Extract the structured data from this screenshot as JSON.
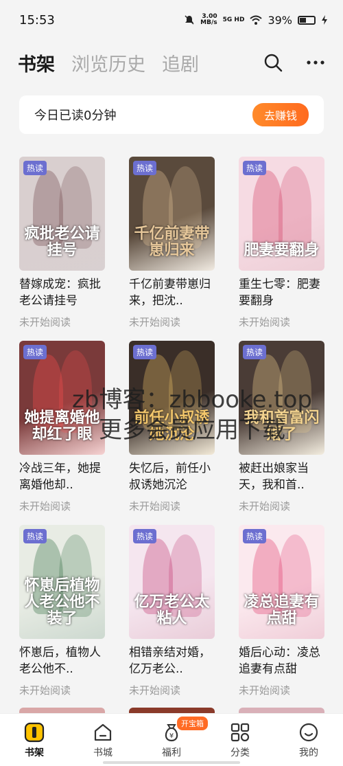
{
  "status": {
    "time": "15:53",
    "speed": "3.00",
    "speed_unit": "MB/s",
    "network": "5G HD",
    "battery": "39%"
  },
  "tabs": [
    {
      "label": "书架",
      "active": true
    },
    {
      "label": "浏览历史",
      "active": false
    },
    {
      "label": "追剧",
      "active": false
    }
  ],
  "reading": {
    "text": "今日已读0分钟",
    "button": "去赚钱"
  },
  "books": [
    {
      "badge": "热读",
      "cover_text": "疯批老公请挂号",
      "title": "替嫁成宠：疯批老公请挂号",
      "status": "未开始阅读",
      "bg": "#d9cfcf",
      "accent": "#6b3e45"
    },
    {
      "badge": "热读",
      "cover_text": "千亿前妻带崽归来",
      "title": "千亿前妻带崽归来，把沈..",
      "status": "未开始阅读",
      "bg": "#5a4a3c",
      "accent": "#e6c79a"
    },
    {
      "badge": "热读",
      "cover_text": "肥妻要翻身",
      "title": "重生七零：肥妻要翻身",
      "status": "未开始阅读",
      "bg": "#f6dbe3",
      "accent": "#d13860"
    },
    {
      "badge": "热读",
      "cover_text": "她提离婚他却红了眼",
      "title": "冷战三年，她提离婚他却..",
      "status": "未开始阅读",
      "bg": "#7a3a3a",
      "accent": "#ff4e4e"
    },
    {
      "badge": "热读",
      "cover_text": "前任小叔诱她沉沦",
      "title": "失忆后，前任小叔诱她沉沦",
      "status": "未开始阅读",
      "bg": "#3a2e28",
      "accent": "#f2c66b"
    },
    {
      "badge": "热读",
      "cover_text": "我和首富闪婚了",
      "title": "被赶出娘家当天，我和首..",
      "status": "未开始阅读",
      "bg": "#4a3c36",
      "accent": "#f3d38f"
    },
    {
      "badge": "热读",
      "cover_text": "怀崽后植物人老公他不装了",
      "title": "怀崽后，植物人老公他不..",
      "status": "未开始阅读",
      "bg": "#e8ece4",
      "accent": "#2f6b3e"
    },
    {
      "badge": "热读",
      "cover_text": "亿万老公太粘人",
      "title": "相错亲结对婚，亿万老公..",
      "status": "未开始阅读",
      "bg": "#f5e6ef",
      "accent": "#c0306b"
    },
    {
      "badge": "热读",
      "cover_text": "凌总追妻有点甜",
      "title": "婚后心动：凌总追妻有点甜",
      "status": "未开始阅读",
      "bg": "#fbe9ee",
      "accent": "#e0356a"
    }
  ],
  "peek_colors": [
    "#d9a7a7",
    "#8a3a2a",
    "#d9b0b8"
  ],
  "watermark": {
    "line1": "zb博客：zbbooke.top",
    "line2": "更多会员应用下载"
  },
  "nav": [
    {
      "label": "书架",
      "icon": "bookshelf-icon",
      "active": true
    },
    {
      "label": "书城",
      "icon": "house-icon",
      "active": false
    },
    {
      "label": "福利",
      "icon": "money-bag-icon",
      "active": false,
      "badge": "开宝箱"
    },
    {
      "label": "分类",
      "icon": "category-grid-icon",
      "active": false
    },
    {
      "label": "我的",
      "icon": "smile-face-icon",
      "active": false
    }
  ]
}
